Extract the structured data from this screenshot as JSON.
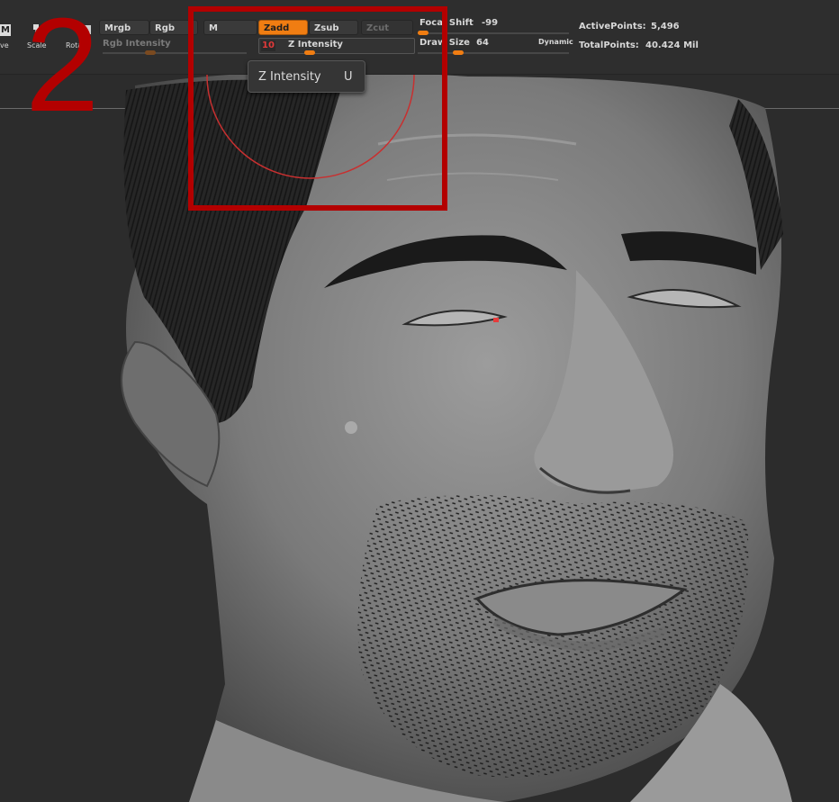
{
  "toolbar": {
    "left_tools": [
      {
        "name": "move",
        "label": "ve",
        "icon": "move-icon"
      },
      {
        "name": "scale",
        "label": "Scale",
        "icon": "scale-icon"
      },
      {
        "name": "rotate",
        "label": "Rota",
        "icon": "rotate-icon"
      }
    ],
    "m_badge": "M",
    "mrgb": "Mrgb",
    "rgb": "Rgb",
    "m": "M",
    "rgb_intensity": "Rgb Intensity",
    "zadd": "Zadd",
    "zsub": "Zsub",
    "zcut": "Zcut",
    "z_intensity": {
      "label": "Z Intensity",
      "value": "10"
    },
    "focal_shift": {
      "label": "Focal Shift",
      "value": "-99"
    },
    "draw_size": {
      "label": "Draw Size",
      "value": "64"
    },
    "dynamic": "Dynamic",
    "active_points": {
      "label": "ActivePoints:",
      "value": "5,496"
    },
    "total_points": {
      "label": "TotalPoints:",
      "value": "40.424 Mil"
    }
  },
  "tooltip": {
    "label": "Z Intensity",
    "hotkey": "U"
  },
  "overlay": {
    "step_number": "2"
  },
  "colors": {
    "accent": "#f07d12",
    "annotation": "#b30000",
    "brush_ring": "#c83030"
  }
}
